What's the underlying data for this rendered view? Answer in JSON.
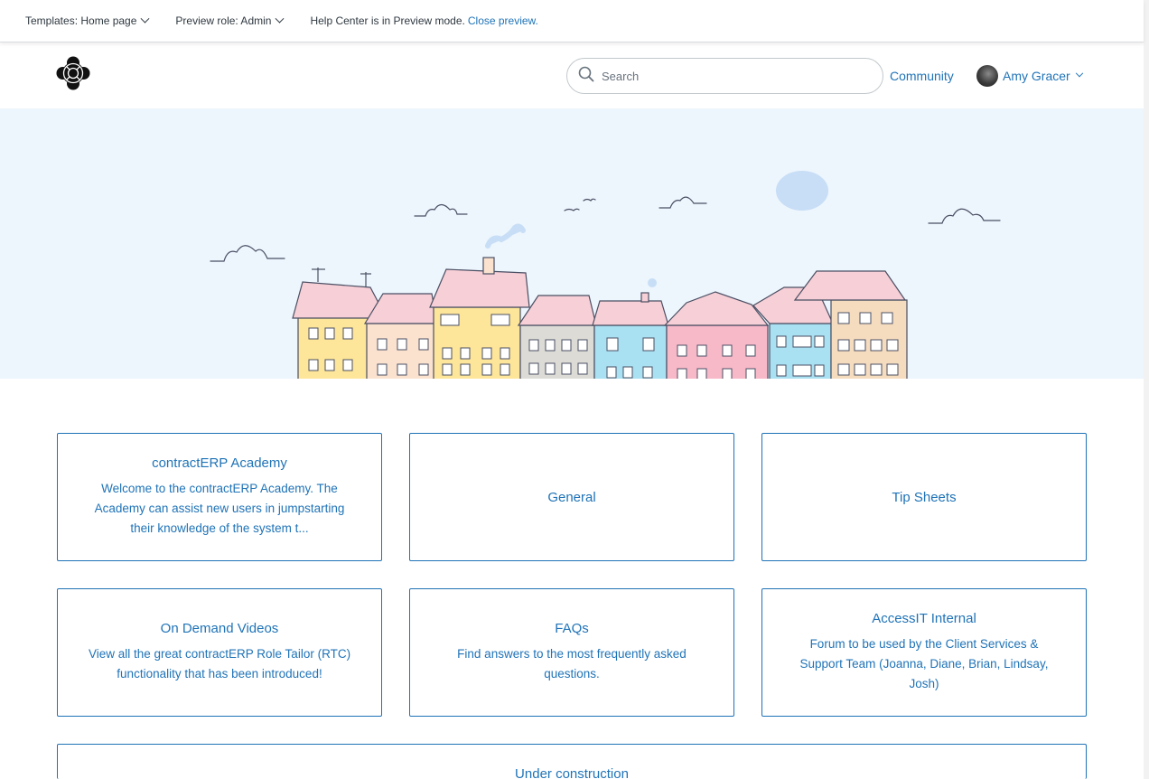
{
  "preview_bar": {
    "template_label": "Templates: Home page",
    "role_label": "Preview role: Admin",
    "status_text": "Help Center is in Preview mode.",
    "close_link": "Close preview."
  },
  "header": {
    "search_placeholder": "Search",
    "community_link": "Community",
    "user_name": "Amy Gracer"
  },
  "categories": [
    {
      "title": "contractERP Academy",
      "description": "Welcome to the contractERP Academy. The Academy can assist new users in jumpstarting their knowledge of the system t..."
    },
    {
      "title": "General",
      "description": ""
    },
    {
      "title": "Tip Sheets",
      "description": ""
    },
    {
      "title": "On Demand Videos",
      "description": "View all the great contractERP Role Tailor (RTC) functionality that has been introduced!"
    },
    {
      "title": "FAQs",
      "description": "Find answers to the most frequently asked questions."
    },
    {
      "title": "AccessIT Internal",
      "description": "Forum to be used by the Client Services & Support Team (Joanna, Diane, Brian, Lindsay, Josh)"
    },
    {
      "title": "Under construction",
      "description": ""
    }
  ],
  "colors": {
    "accent": "#1f73b7",
    "hero_bg": "#edf5fd"
  },
  "icons": {
    "logo": "lifebuoy-logo-icon",
    "search": "search-icon",
    "chevron": "chevron-down-icon"
  }
}
